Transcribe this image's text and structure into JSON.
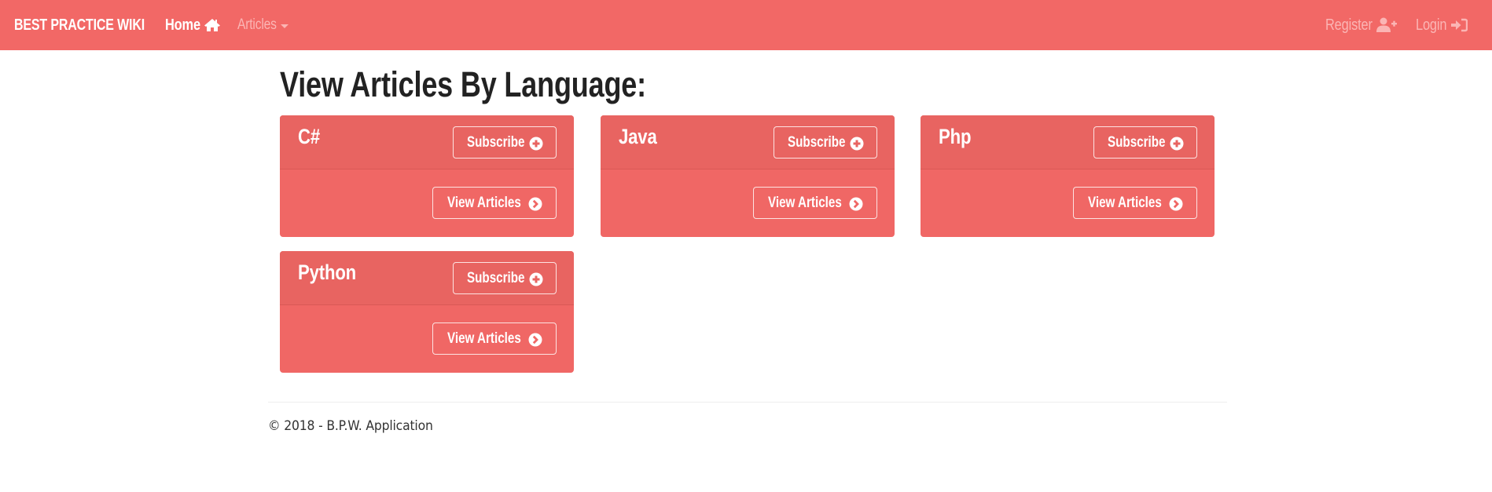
{
  "navbar": {
    "brand": "BEST PRACTICE WIKI",
    "home_label": "Home",
    "home_icon": "home-icon",
    "articles_label": "Articles",
    "articles_icon": "caret-down-icon",
    "register_label": "Register",
    "register_icon": "user-plus-icon",
    "login_label": "Login",
    "login_icon": "sign-in-icon"
  },
  "main": {
    "title": "View Articles By Language:",
    "cards": [
      {
        "language": "C#",
        "subscribe_label": "Subscribe",
        "view_label": "View Articles"
      },
      {
        "language": "Java",
        "subscribe_label": "Subscribe",
        "view_label": "View Articles"
      },
      {
        "language": "Php",
        "subscribe_label": "Subscribe",
        "view_label": "View Articles"
      },
      {
        "language": "Python",
        "subscribe_label": "Subscribe",
        "view_label": "View Articles"
      }
    ]
  },
  "footer": {
    "text": "© 2018 - B.P.W. Application"
  },
  "colors": {
    "navbar": "#f26866",
    "card_body": "#f06765",
    "card_header": "#e86461",
    "nav_muted_text": "#fbb5b4"
  }
}
